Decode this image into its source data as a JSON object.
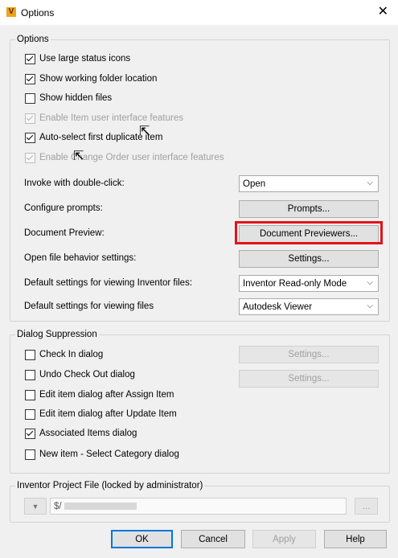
{
  "window": {
    "title": "Options",
    "close_glyph": "✕"
  },
  "options_group": {
    "legend": "Options",
    "checkboxes": [
      {
        "label": "Use large status icons",
        "checked": true,
        "disabled": false
      },
      {
        "label": "Show working folder location",
        "checked": true,
        "disabled": false
      },
      {
        "label": "Show hidden files",
        "checked": false,
        "disabled": false
      },
      {
        "label": "Enable Item user interface features",
        "checked": true,
        "disabled": true
      },
      {
        "label": "Auto-select first duplicate item",
        "checked": true,
        "disabled": false
      },
      {
        "label": "Enable Change Order user interface features",
        "checked": true,
        "disabled": true
      }
    ],
    "invoke_label": "Invoke with double-click:",
    "invoke_value": "Open",
    "prompts_label": "Configure prompts:",
    "prompts_button": "Prompts...",
    "doc_preview_label": "Document Preview:",
    "doc_preview_button": "Document Previewers...",
    "open_file_label": "Open file behavior settings:",
    "open_file_button": "Settings...",
    "inventor_view_label": "Default settings for viewing Inventor files:",
    "inventor_view_value": "Inventor Read-only Mode",
    "files_view_label": "Default settings for viewing files",
    "files_view_value": "Autodesk Viewer"
  },
  "dialog_suppression": {
    "legend": "Dialog Suppression",
    "checkboxes": [
      {
        "label": "Check In dialog",
        "checked": false
      },
      {
        "label": "Undo Check Out dialog",
        "checked": false
      },
      {
        "label": "Edit item dialog after Assign Item",
        "checked": false
      },
      {
        "label": "Edit item dialog after Update Item",
        "checked": false
      },
      {
        "label": "Associated Items dialog",
        "checked": true
      },
      {
        "label": "New item - Select Category dialog",
        "checked": false
      }
    ],
    "settings_button_1": "Settings...",
    "settings_button_2": "Settings..."
  },
  "project_file": {
    "legend": "Inventor Project File (locked by administrator)",
    "path_value": "$/",
    "browse_label": "..."
  },
  "footer": {
    "ok": "OK",
    "cancel": "Cancel",
    "apply": "Apply",
    "help": "Help"
  },
  "colors": {
    "highlight": "#e0141b",
    "accent": "#0078d7"
  }
}
